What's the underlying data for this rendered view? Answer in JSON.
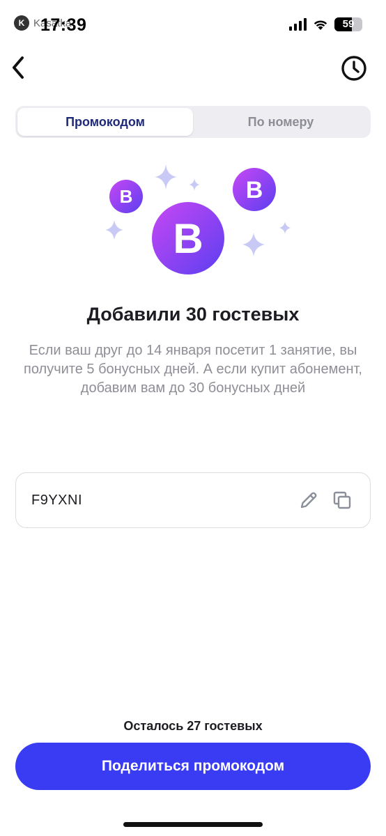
{
  "status_bar": {
    "time": "17:39",
    "app_badge": "K",
    "app_name": "Kasatka",
    "battery": "59"
  },
  "nav": {
    "back_icon": "chevron-left-icon",
    "history_icon": "clock-icon"
  },
  "tabs": [
    {
      "label": "Промокодом",
      "active": true
    },
    {
      "label": "По номеру",
      "active": false
    }
  ],
  "illustration": {
    "coin_letter": "B",
    "colors": {
      "coin_start": "#c847f4",
      "coin_end": "#5b3ff0",
      "sparkle": "#c9c9f5"
    }
  },
  "headline": "Добавили 30 гостевых",
  "description": "Если ваш друг до 14 января посетит 1 занятие, вы получите 5 бонусных дней. А если купит абонемент, добавим вам до 30 бонусных дней",
  "promo": {
    "code": "F9YXNI",
    "edit_icon": "pencil-icon",
    "copy_icon": "copy-icon"
  },
  "remaining_label": "Осталось 27 гостевых",
  "share_button": "Поделиться промокодом",
  "colors": {
    "accent": "#3a3cf3",
    "active_tab_text": "#1e2a78",
    "secondary_text": "#8e8e96"
  }
}
